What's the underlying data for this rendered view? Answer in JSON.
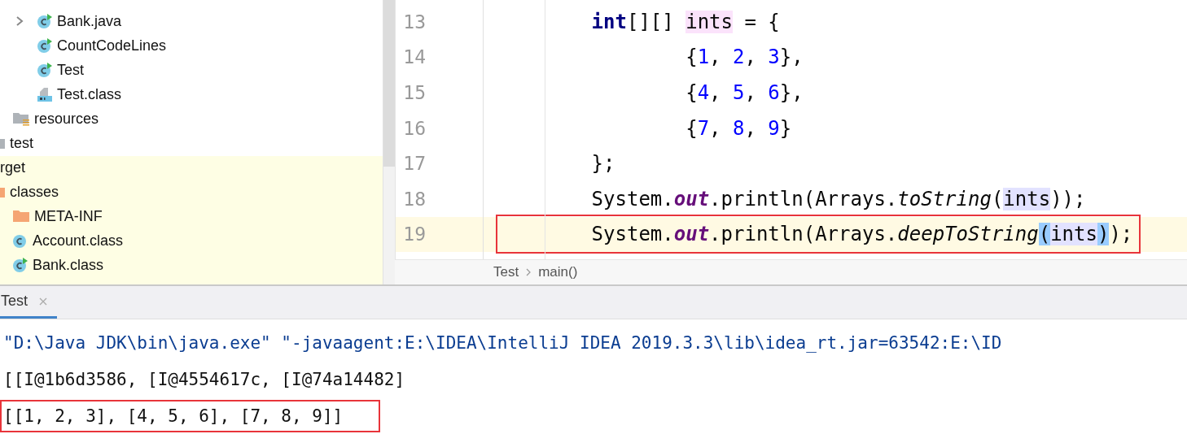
{
  "project_tree": [
    {
      "children": [
        {
          "children": [
            {
              "children": [
                {
                  "label": "Bank.java",
                  "kind": "class-run",
                  "expanded": false
                },
                {
                  "label": "CountCodeLines",
                  "kind": "class-run"
                },
                {
                  "label": "Test",
                  "kind": "class-run"
                },
                {
                  "label": "Test.class",
                  "kind": "class-file"
                }
              ]
            },
            {
              "label": "resources",
              "kind": "folder-resources"
            }
          ]
        },
        {
          "label": "test",
          "kind": "folder-gray"
        }
      ]
    },
    {
      "label": "rget",
      "children": [
        {
          "label": "classes",
          "kind": "folder-orange",
          "children": [
            {
              "label": "META-INF",
              "kind": "folder-orange"
            },
            {
              "label": "Account.class",
              "kind": "class"
            },
            {
              "label": "Bank.class",
              "kind": "class-run"
            }
          ]
        }
      ]
    }
  ],
  "editor": {
    "lines": [
      {
        "number": "13",
        "current": false,
        "boxed": false,
        "tokens": [
          {
            "text": "        int",
            "kind": "keyword"
          },
          {
            "text": "[][] ",
            "kind": "plain"
          },
          {
            "text": "ints",
            "kind": "declaration"
          },
          {
            "text": " = {",
            "kind": "plain"
          }
        ]
      },
      {
        "number": "14",
        "current": false,
        "boxed": false,
        "tokens": [
          {
            "text": "                {",
            "kind": "plain"
          },
          {
            "text": "1",
            "kind": "number"
          },
          {
            "text": ", ",
            "kind": "plain"
          },
          {
            "text": "2",
            "kind": "number"
          },
          {
            "text": ", ",
            "kind": "plain"
          },
          {
            "text": "3",
            "kind": "number"
          },
          {
            "text": "},",
            "kind": "plain"
          }
        ]
      },
      {
        "number": "15",
        "current": false,
        "boxed": false,
        "tokens": [
          {
            "text": "                {",
            "kind": "plain"
          },
          {
            "text": "4",
            "kind": "number"
          },
          {
            "text": ", ",
            "kind": "plain"
          },
          {
            "text": "5",
            "kind": "number"
          },
          {
            "text": ", ",
            "kind": "plain"
          },
          {
            "text": "6",
            "kind": "number"
          },
          {
            "text": "},",
            "kind": "plain"
          }
        ]
      },
      {
        "number": "16",
        "current": false,
        "boxed": false,
        "tokens": [
          {
            "text": "                {",
            "kind": "plain"
          },
          {
            "text": "7",
            "kind": "number"
          },
          {
            "text": ", ",
            "kind": "plain"
          },
          {
            "text": "8",
            "kind": "number"
          },
          {
            "text": ", ",
            "kind": "plain"
          },
          {
            "text": "9",
            "kind": "number"
          },
          {
            "text": "}",
            "kind": "plain"
          }
        ]
      },
      {
        "number": "17",
        "current": false,
        "boxed": false,
        "tokens": [
          {
            "text": "        };",
            "kind": "plain"
          }
        ]
      },
      {
        "number": "18",
        "current": false,
        "boxed": false,
        "tokens": [
          {
            "text": "        System.",
            "kind": "plain"
          },
          {
            "text": "out",
            "kind": "static-field"
          },
          {
            "text": ".println(Arrays.",
            "kind": "plain"
          },
          {
            "text": "toString",
            "kind": "static-method"
          },
          {
            "text": "(",
            "kind": "plain"
          },
          {
            "text": "ints",
            "kind": "usage"
          },
          {
            "text": "));",
            "kind": "plain"
          }
        ]
      },
      {
        "number": "19",
        "current": true,
        "boxed": true,
        "tokens": [
          {
            "text": "        System.",
            "kind": "plain"
          },
          {
            "text": "out",
            "kind": "static-field"
          },
          {
            "text": ".println(Arrays.",
            "kind": "plain"
          },
          {
            "text": "deepToString",
            "kind": "static-method"
          },
          {
            "text": "(",
            "kind": "brace-match"
          },
          {
            "text": "ints",
            "kind": "usage"
          },
          {
            "text": ")",
            "kind": "brace-match"
          },
          {
            "text": ");",
            "kind": "plain"
          }
        ]
      }
    ],
    "breadcrumbs": [
      "Test",
      "main()"
    ]
  },
  "run_panel": {
    "tabs": [
      {
        "label": "Test",
        "selected": true
      }
    ],
    "lines": [
      {
        "text": "\"D:\\Java JDK\\bin\\java.exe\" \"-javaagent:E:\\IDEA\\IntelliJ IDEA 2019.3.3\\lib\\idea_rt.jar=63542:E:\\ID",
        "kind": "command",
        "boxed": false
      },
      {
        "text": "[[I@1b6d3586, [I@4554617c, [I@74a14482]",
        "kind": "output",
        "boxed": false
      },
      {
        "text": "[[1, 2, 3], [4, 5, 6], [7, 8, 9]]",
        "kind": "output",
        "boxed": true
      }
    ]
  }
}
